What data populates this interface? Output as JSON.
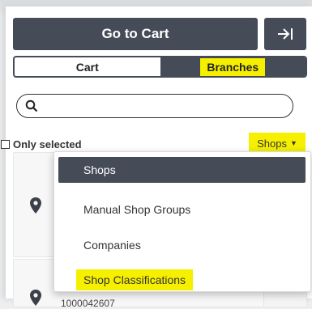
{
  "header": {
    "go_to_cart_label": "Go to Cart",
    "exit_icon": "sidebar-exit-icon"
  },
  "tabs": [
    {
      "label": "Cart",
      "active": false
    },
    {
      "label": "Branches",
      "active": true,
      "highlighted": true
    }
  ],
  "search": {
    "value": "",
    "placeholder": "",
    "icon": "search-icon"
  },
  "filter": {
    "only_selected_label": "Only selected",
    "only_selected_checked": false
  },
  "shops_dropdown": {
    "label": "Shops",
    "highlighted": true,
    "options": [
      {
        "label": "Shops",
        "selected": true
      },
      {
        "label": "Manual Shop Groups",
        "selected": false
      },
      {
        "label": "Companies",
        "selected": false
      },
      {
        "label": "Shop Classifications",
        "selected": false,
        "highlighted": true
      }
    ]
  },
  "cards": [
    {
      "icon": "location-pin-icon",
      "text": ""
    },
    {
      "icon": "location-pin-icon",
      "text": "1000042607"
    }
  ],
  "colors": {
    "dark": "#464c57",
    "highlight": "#f6f000",
    "panel": "#ffffff",
    "card": "#f7f7f8"
  }
}
